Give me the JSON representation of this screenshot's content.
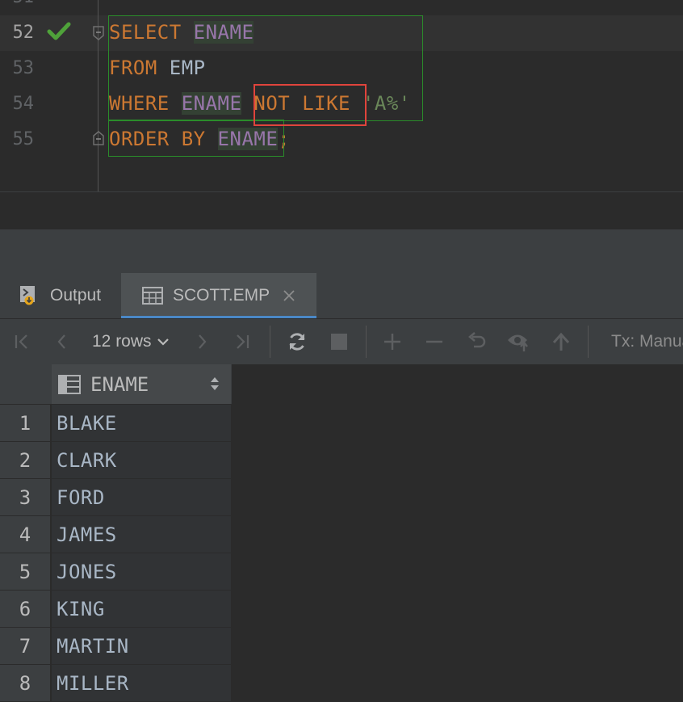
{
  "editor": {
    "partial_line_number": "51",
    "lines": [
      {
        "number": "52",
        "tokens": [
          "SELECT",
          "ENAME"
        ]
      },
      {
        "number": "53",
        "tokens": [
          "FROM",
          "EMP"
        ]
      },
      {
        "number": "54",
        "tokens": [
          "WHERE",
          "ENAME",
          "NOT LIKE",
          "'A%'"
        ]
      },
      {
        "number": "55",
        "tokens": [
          "ORDER BY",
          "ENAME",
          ";"
        ]
      }
    ],
    "status_icon": "check-icon",
    "colors": {
      "keyword": "#cc7832",
      "identifier": "#9876aa",
      "string": "#6a8759",
      "highlight_box": "#e0443c",
      "statement_box": "#2a8c2a"
    }
  },
  "tabs": [
    {
      "label": "Output",
      "icon": "output-icon",
      "active": false
    },
    {
      "label": "SCOTT.EMP",
      "icon": "table-icon",
      "active": true
    }
  ],
  "toolbar": {
    "rows_label": "12 rows",
    "tx_label": "Tx: Manual"
  },
  "grid": {
    "column": "ENAME",
    "rows": [
      {
        "n": "1",
        "ename": "BLAKE"
      },
      {
        "n": "2",
        "ename": "CLARK"
      },
      {
        "n": "3",
        "ename": "FORD"
      },
      {
        "n": "4",
        "ename": "JAMES"
      },
      {
        "n": "5",
        "ename": "JONES"
      },
      {
        "n": "6",
        "ename": "KING"
      },
      {
        "n": "7",
        "ename": "MARTIN"
      },
      {
        "n": "8",
        "ename": "MILLER"
      }
    ]
  }
}
